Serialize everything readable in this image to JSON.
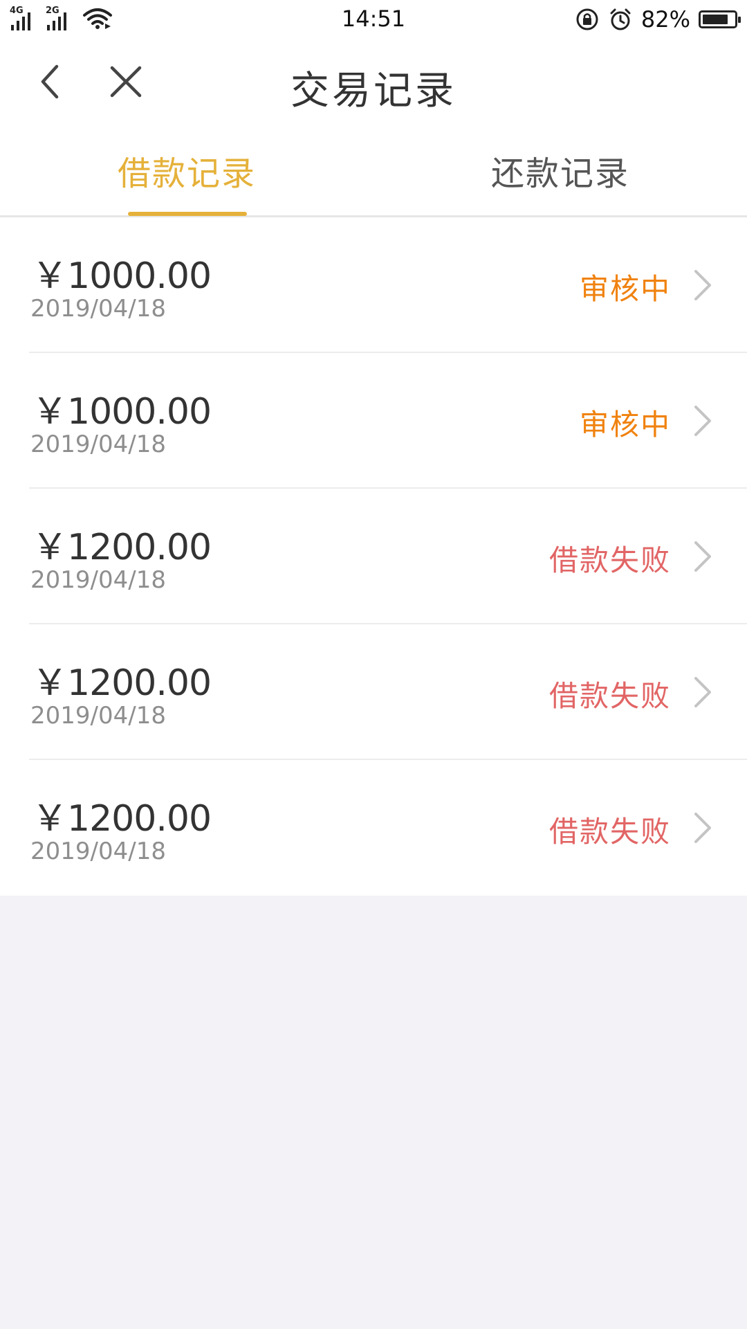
{
  "status_bar": {
    "network1": "4G",
    "network2": "2G",
    "time": "14:51",
    "battery_percent": "82%",
    "battery_level": 0.82
  },
  "header": {
    "title": "交易记录",
    "back_icon": "chevron-left-icon",
    "close_icon": "close-icon"
  },
  "tabs": [
    {
      "label": "借款记录",
      "active": true
    },
    {
      "label": "还款记录",
      "active": false
    }
  ],
  "colors": {
    "accent": "#e5b13a",
    "status_review": "#f0820f",
    "status_failed": "#e26565",
    "page_background": "#f2f2f7"
  },
  "records": [
    {
      "amount": "￥1000.00",
      "date": "2019/04/18",
      "status": "审核中",
      "status_type": "review"
    },
    {
      "amount": "￥1000.00",
      "date": "2019/04/18",
      "status": "审核中",
      "status_type": "review"
    },
    {
      "amount": "￥1200.00",
      "date": "2019/04/18",
      "status": "借款失败",
      "status_type": "failed"
    },
    {
      "amount": "￥1200.00",
      "date": "2019/04/18",
      "status": "借款失败",
      "status_type": "failed"
    },
    {
      "amount": "￥1200.00",
      "date": "2019/04/18",
      "status": "借款失败",
      "status_type": "failed"
    }
  ]
}
